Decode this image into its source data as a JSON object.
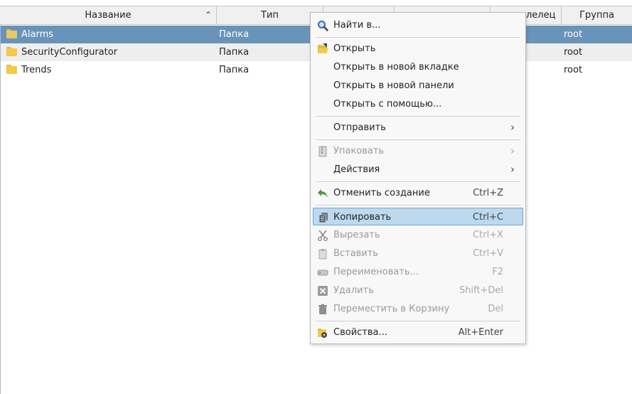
{
  "columns": {
    "name": "Название",
    "type": "Тип",
    "owner": "лелец",
    "group": "Группа"
  },
  "rows": [
    {
      "name": "Alarms",
      "type": "Папка",
      "group": "root"
    },
    {
      "name": "SecurityConfigurator",
      "type": "Папка",
      "group": "root"
    },
    {
      "name": "Trends",
      "type": "Папка",
      "group": "root"
    }
  ],
  "menu": {
    "find": "Найти в...",
    "open": "Открыть",
    "open_tab": "Открыть в новой вкладке",
    "open_panel": "Открыть в новой панели",
    "open_with": "Открыть с помощью...",
    "send": "Отправить",
    "pack": "Упаковать",
    "actions": "Действия",
    "undo": "Отменить создание",
    "undo_sc": "Ctrl+Z",
    "copy": "Копировать",
    "copy_sc": "Ctrl+C",
    "cut": "Вырезать",
    "cut_sc": "Ctrl+X",
    "paste": "Вставить",
    "paste_sc": "Ctrl+V",
    "rename": "Переименовать...",
    "rename_sc": "F2",
    "delete": "Удалить",
    "delete_sc": "Shift+Del",
    "trash": "Переместить в Корзину",
    "trash_sc": "Del",
    "properties": "Свойства...",
    "properties_sc": "Alt+Enter"
  },
  "colors": {
    "selection": "#6a93b9",
    "menu_highlight": "#bcd9ee",
    "folder": "#f5c94b"
  }
}
